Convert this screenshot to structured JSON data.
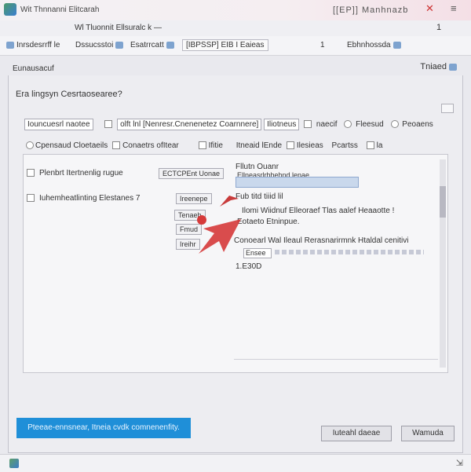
{
  "window": {
    "title": "Wit Thnnanni Elitcarah",
    "subtitle": "[[EP]] Manhnazb",
    "close_glyph": "✕",
    "menu_glyph": "≡"
  },
  "tabbar": {
    "label": "Wl Tluonnit Ellsuralc k —",
    "number": "1"
  },
  "toolbar": {
    "items": [
      "Inrsdesrrff le",
      "Dssucsstoi",
      "Esatrrcatt",
      "[IBPSSP] EIB I Eaieas",
      "1",
      "Ebhnhossda"
    ]
  },
  "panel": {
    "title": "Eunausacuf",
    "right_label": "Tniaed"
  },
  "content": {
    "question": "Era lingsyn Cesrtaosearee?",
    "row1": {
      "label": "Iouncuesrl naotee",
      "value": "olft lnl [Nenresr.Cnenenetez Coarnnere]",
      "button": "Iliotneus",
      "tail1": "naecif",
      "tail2": "Fleesud",
      "tail3": "Peoaens"
    },
    "row2": {
      "opt1": "Cpensaud Cloetaeils",
      "opt2": "Conaetrs ofItear",
      "opt3": "Ifitie",
      "opt4": "Itneaid lEnde",
      "opt5": "Ilesieas",
      "opt6": "Pcartss",
      "tail": "la"
    }
  },
  "inner": {
    "left1_label": "Plenbrt Itertnenlig rugue",
    "left1_field": "ECTCPEnt Uonae",
    "left2_label": "Iuhemheatlinting Elestanes 7",
    "left2_btn": "Ireenepe",
    "btn_a": "Tenaeh",
    "btn_b": "Fmud",
    "btn_c": "Ireihr",
    "r1": "Fllutn Ouanr",
    "r2": "Ellneasrlrhhehnd lenae",
    "r3": "Fub titd tiiid lil",
    "r4": "Ilomi Wiidnuf Elleoraef Tlas aalef Heaaotte !",
    "r5": "Eotaeto Etninpue.",
    "r6": "Conoearl Wal Ileaul Rerasnarirmnk Htaldal cenitivi",
    "r6_field": "Ensee",
    "r7": "1.E30D"
  },
  "footer": {
    "status": "Pteeae-ennsnear, Itneia cvdk comnenenfity.",
    "btn1": "Iuteahl daeae",
    "btn2": "Wamuda"
  },
  "colors": {
    "accent": "#1f8fd8",
    "arrow": "#d63a3a"
  }
}
